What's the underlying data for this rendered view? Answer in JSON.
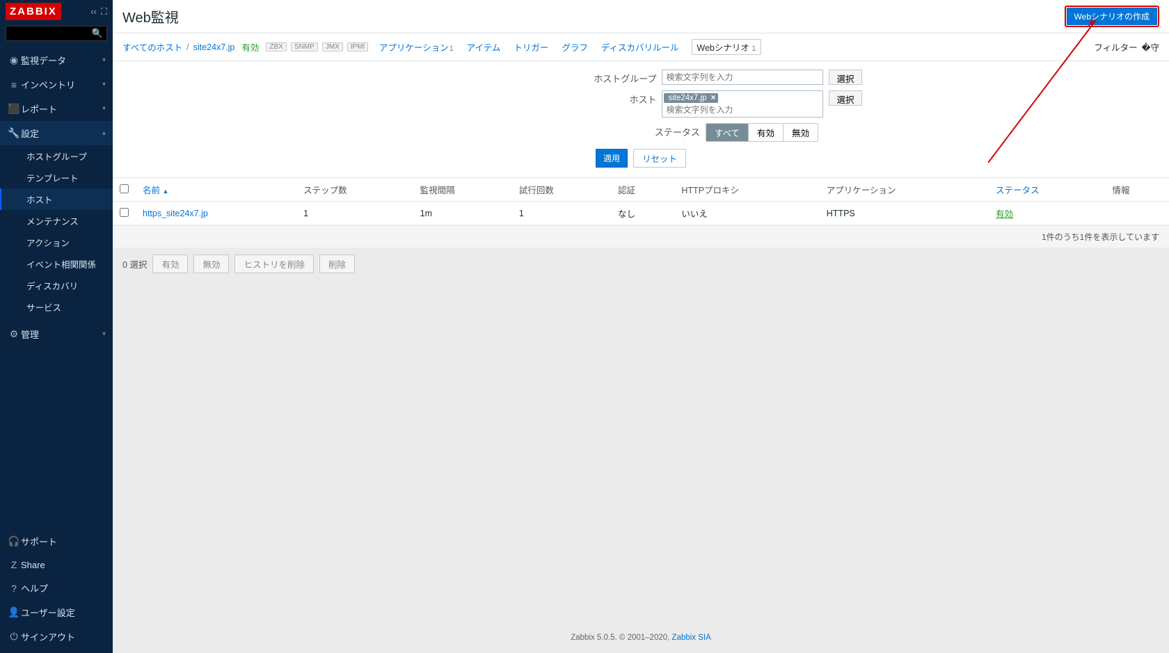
{
  "sidebar": {
    "logo": "ZABBIX",
    "search_placeholder": "",
    "menu": [
      {
        "icon": "◉",
        "label": "監視データ",
        "sub": null
      },
      {
        "icon": "≡",
        "label": "インベントリ",
        "sub": null
      },
      {
        "icon": "▥",
        "label": "レポート",
        "sub": null
      },
      {
        "icon": "🔧",
        "label": "設定",
        "active": true,
        "sub": [
          {
            "label": "ホストグループ"
          },
          {
            "label": "テンプレート"
          },
          {
            "label": "ホスト",
            "selected": true
          },
          {
            "label": "メンテナンス"
          },
          {
            "label": "アクション"
          },
          {
            "label": "イベント相関関係"
          },
          {
            "label": "ディスカバリ"
          },
          {
            "label": "サービス"
          }
        ]
      },
      {
        "icon": "⚙",
        "label": "管理",
        "sub": null
      }
    ],
    "bottom": [
      {
        "icon": "🎧",
        "label": "サポート"
      },
      {
        "icon": "⇪",
        "label": "Share"
      },
      {
        "icon": "?",
        "label": "ヘルプ"
      },
      {
        "icon": "👤",
        "label": "ユーザー設定"
      },
      {
        "icon": "⏻",
        "label": "サインアウト"
      }
    ]
  },
  "header": {
    "title": "Web監視",
    "create_btn": "Webシナリオの作成"
  },
  "crumb": {
    "all_hosts": "すべてのホスト",
    "host": "site24x7.jp",
    "status": "有効",
    "tags": [
      "ZBX",
      "SNMP",
      "JMX",
      "IPMI"
    ],
    "links": [
      {
        "label": "アプリケーション",
        "count": "1"
      },
      {
        "label": "アイテム"
      },
      {
        "label": "トリガー"
      },
      {
        "label": "グラフ"
      },
      {
        "label": "ディスカバリルール"
      }
    ],
    "active_tab": {
      "label": "Webシナリオ",
      "count": "1"
    },
    "filter_label": "フィルター"
  },
  "filter": {
    "hostgroup_label": "ホストグループ",
    "host_label": "ホスト",
    "status_label": "ステータス",
    "placeholder": "検索文字列を入力",
    "select_btn": "選択",
    "host_tag": "site24x7.jp",
    "status_opts": [
      "すべて",
      "有効",
      "無効"
    ],
    "apply": "適用",
    "reset": "リセット"
  },
  "table": {
    "cols": [
      "名前",
      "ステップ数",
      "監視間隔",
      "試行回数",
      "認証",
      "HTTPプロキシ",
      "アプリケーション",
      "ステータス",
      "情報"
    ],
    "row": {
      "name": "https_site24x7.jp",
      "steps": "1",
      "interval": "1m",
      "retries": "1",
      "auth": "なし",
      "proxy": "いいえ",
      "app": "HTTPS",
      "status": "有効",
      "info": ""
    },
    "summary": "1件のうち1件を表示しています"
  },
  "bulk": {
    "selected": "0 選択",
    "buttons": [
      "有効",
      "無効",
      "ヒストリを削除",
      "削除"
    ]
  },
  "footer": {
    "text": "Zabbix 5.0.5. © 2001–2020, ",
    "link": "Zabbix SIA"
  }
}
